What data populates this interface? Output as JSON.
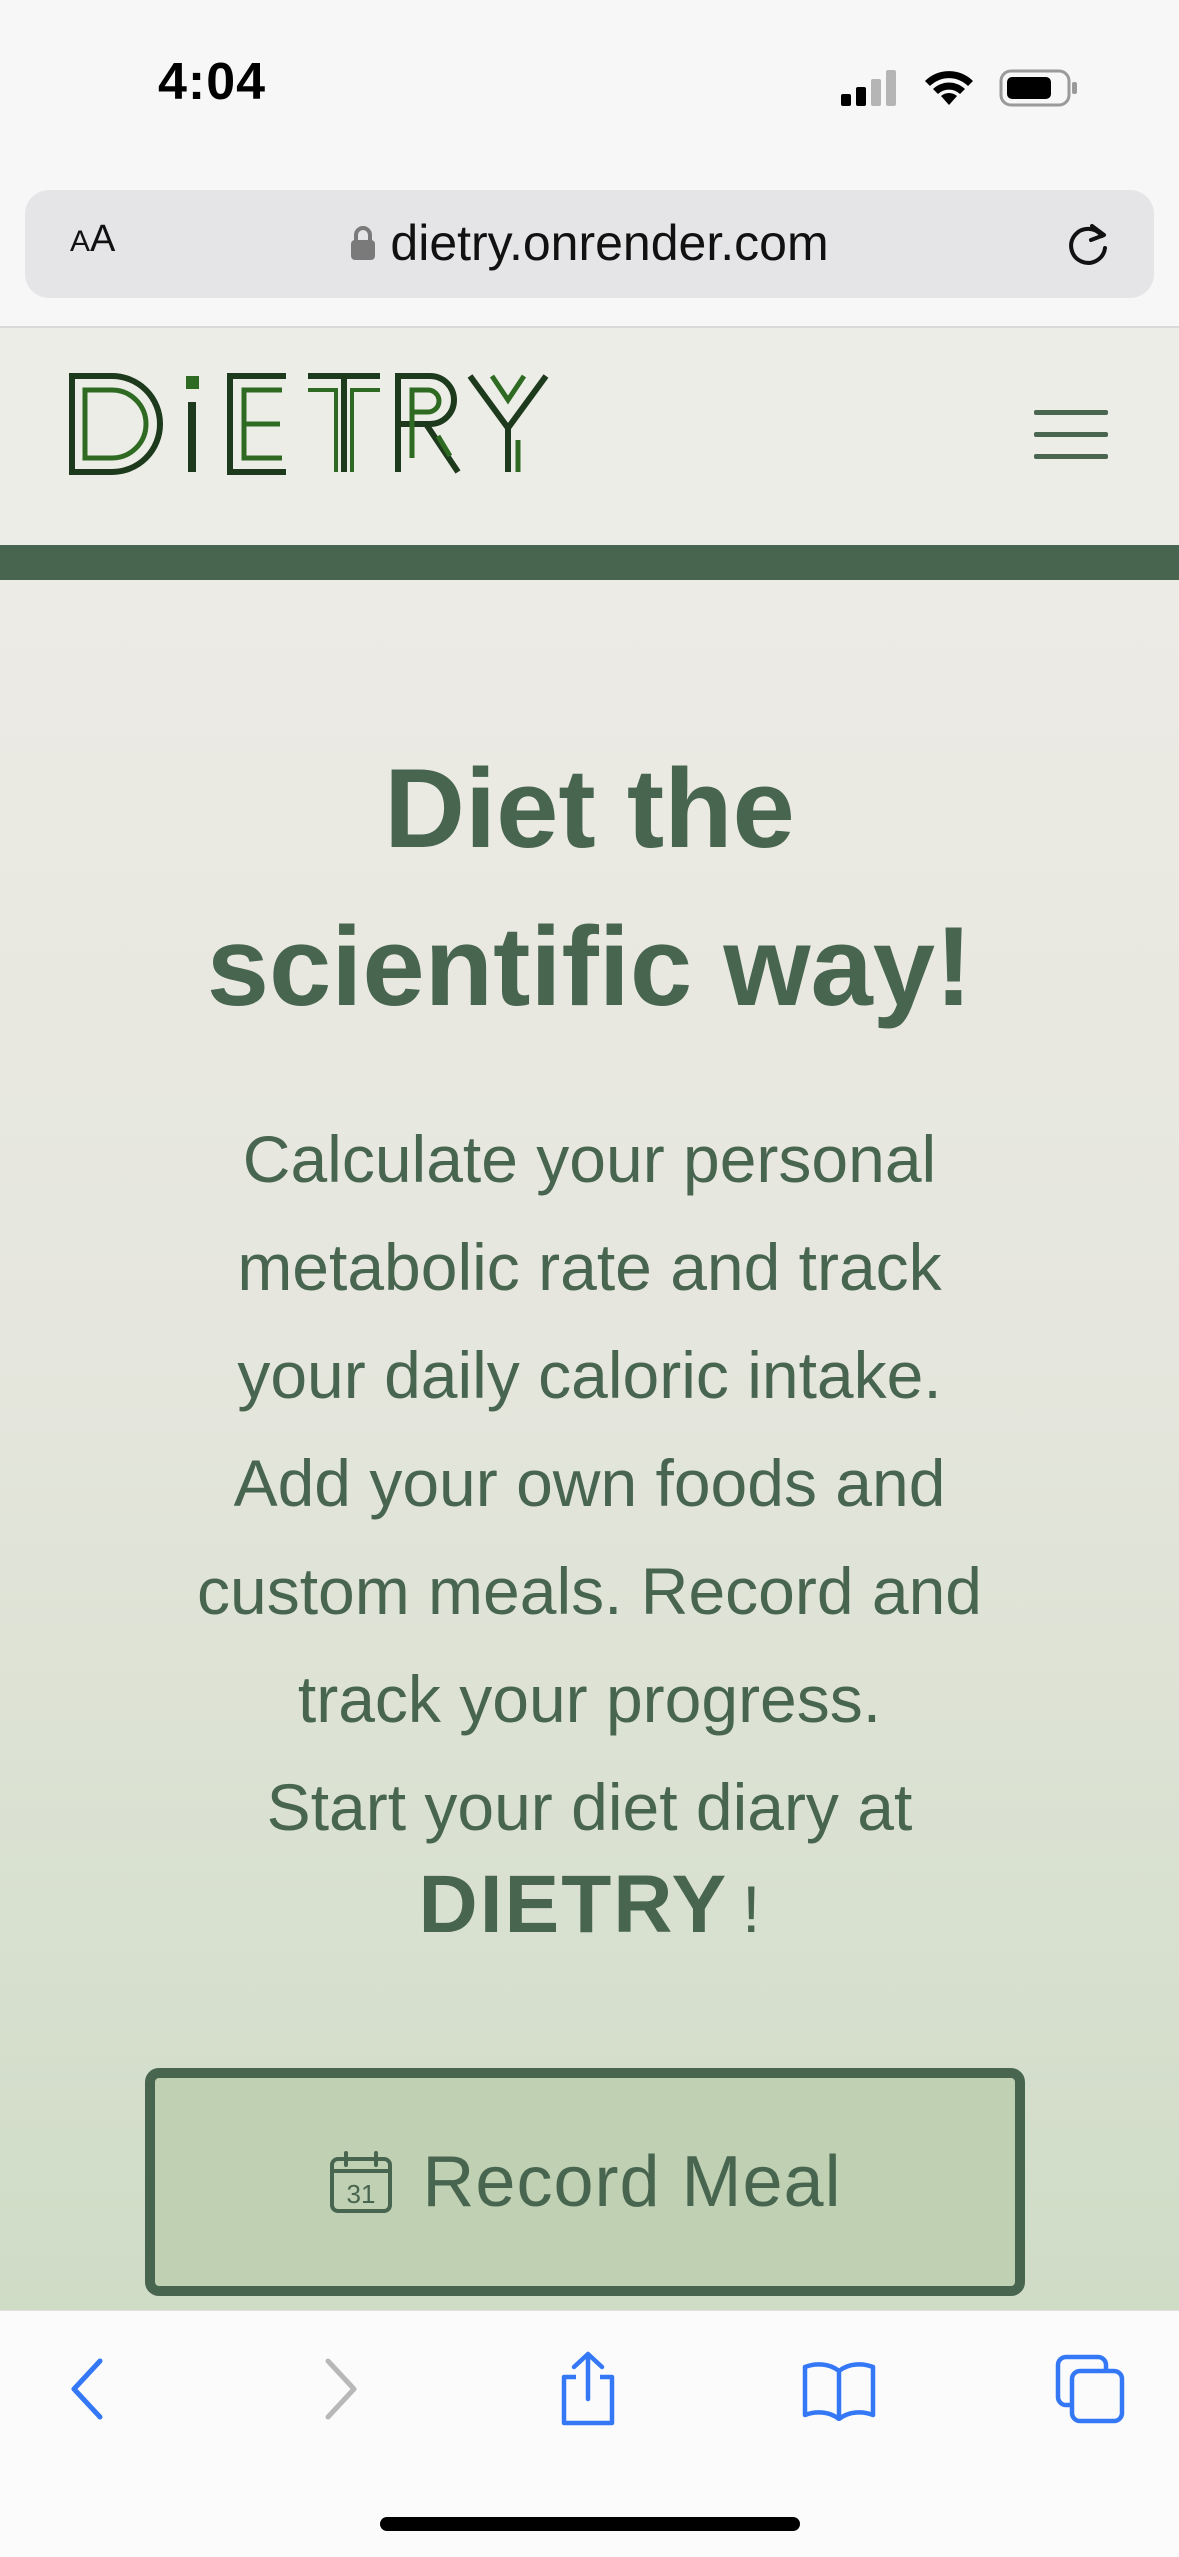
{
  "status_bar": {
    "time": "4:04"
  },
  "browser": {
    "text_size_label_small": "A",
    "text_size_label_large": "A",
    "url": "dietry.onrender.com"
  },
  "header": {
    "logo_text": "DiETRY"
  },
  "hero": {
    "title_line1": "Diet the",
    "title_line2": "scientific way!",
    "desc_lines": [
      "Calculate your personal",
      "metabolic rate and track",
      "your daily caloric intake.",
      "Add your own foods and",
      "custom meals. Record and",
      "track your progress.",
      "Start your diet diary at"
    ],
    "brand": "DIETRY",
    "brand_suffix": "!",
    "record_button_label": "Record Meal",
    "calendar_day": "31"
  },
  "colors": {
    "brand_green": "#486550",
    "button_fill": "#c0d0b2",
    "ios_blue": "#3478f6"
  },
  "icons": [
    "lock-icon",
    "reload-icon",
    "hamburger-menu-icon",
    "calendar-icon",
    "back-icon",
    "forward-icon",
    "share-icon",
    "bookmarks-icon",
    "tabs-icon"
  ]
}
